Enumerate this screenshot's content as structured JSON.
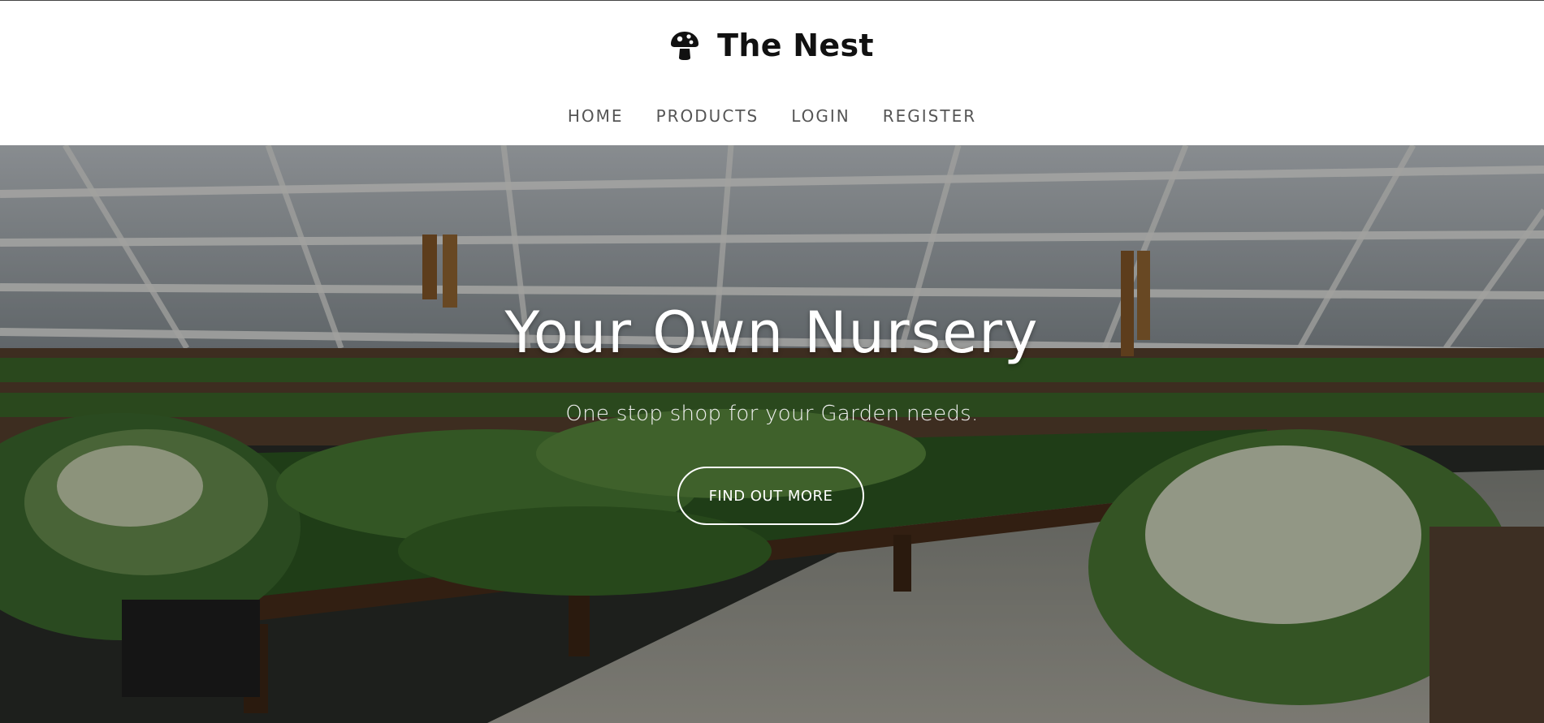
{
  "brand": {
    "icon": "mushroom-icon",
    "title": "The Nest"
  },
  "nav": {
    "items": [
      {
        "label": "HOME"
      },
      {
        "label": "PRODUCTS"
      },
      {
        "label": "LOGIN"
      },
      {
        "label": "REGISTER"
      }
    ]
  },
  "hero": {
    "heading": "Your Own Nursery",
    "subheading": "One stop shop for your Garden needs.",
    "cta_label": "FIND OUT MORE",
    "background": "greenhouse-nursery-photo"
  },
  "colors": {
    "header_bg": "#ffffff",
    "brand_text": "#111111",
    "nav_text": "#555555",
    "hero_text": "#ffffff"
  }
}
